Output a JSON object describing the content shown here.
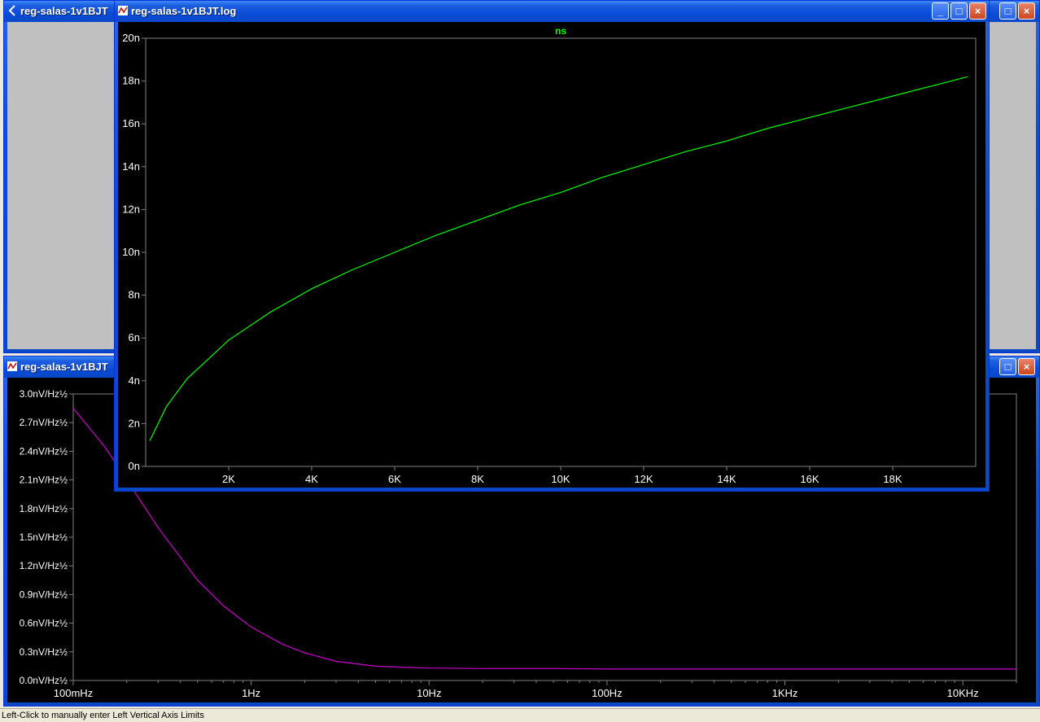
{
  "windows": {
    "schematic": {
      "title": "reg-salas-1v1BJT"
    },
    "noise_plot": {
      "title": "reg-salas-1v1BJT"
    },
    "log_plot": {
      "title": "reg-salas-1v1BJT.log"
    }
  },
  "status_text": "Left-Click to manually enter Left Vertical Axis Limits",
  "colors": {
    "trace_green": "#00ff00",
    "trace_magenta": "#cc00cc",
    "grid": "#808080",
    "axis_text": "#ffffff"
  },
  "chart_data": [
    {
      "type": "line",
      "legend_label": "ns",
      "x_ticks": [
        "2K",
        "4K",
        "6K",
        "8K",
        "10K",
        "12K",
        "14K",
        "16K",
        "18K"
      ],
      "y_ticks": [
        "0n",
        "2n",
        "4n",
        "6n",
        "8n",
        "10n",
        "12n",
        "14n",
        "16n",
        "18n",
        "20n"
      ],
      "xlim": [
        0,
        20000
      ],
      "ylim": [
        0,
        20
      ],
      "series": [
        {
          "x": [
            100,
            500,
            1000,
            2000,
            3000,
            4000,
            5000,
            6000,
            7000,
            8000,
            9000,
            10000,
            11000,
            12000,
            13000,
            14000,
            15000,
            16000,
            17000,
            18000,
            19000,
            19800
          ],
          "y": [
            1.2,
            2.8,
            4.1,
            5.9,
            7.2,
            8.3,
            9.2,
            10.0,
            10.8,
            11.5,
            12.2,
            12.8,
            13.5,
            14.1,
            14.7,
            15.2,
            15.8,
            16.3,
            16.8,
            17.3,
            17.8,
            18.2
          ]
        }
      ]
    },
    {
      "type": "line",
      "x_scale": "log",
      "x_ticks": [
        "100mHz",
        "1Hz",
        "10Hz",
        "100Hz",
        "1KHz",
        "10KHz"
      ],
      "y_ticks": [
        "0.0nV/Hz½",
        "0.3nV/Hz½",
        "0.6nV/Hz½",
        "0.9nV/Hz½",
        "1.2nV/Hz½",
        "1.5nV/Hz½",
        "1.8nV/Hz½",
        "2.1nV/Hz½",
        "2.4nV/Hz½",
        "2.7nV/Hz½",
        "3.0nV/Hz½"
      ],
      "xlim": [
        0.1,
        20000
      ],
      "ylim": [
        0,
        3.0
      ],
      "series": [
        {
          "x": [
            0.1,
            0.15,
            0.2,
            0.3,
            0.5,
            0.7,
            1,
            1.5,
            2,
            3,
            5,
            7,
            10,
            20,
            50,
            100,
            1000,
            10000,
            20000
          ],
          "y": [
            2.85,
            2.45,
            2.1,
            1.6,
            1.05,
            0.78,
            0.56,
            0.38,
            0.29,
            0.2,
            0.15,
            0.14,
            0.13,
            0.125,
            0.125,
            0.12,
            0.12,
            0.12,
            0.12
          ]
        }
      ]
    }
  ]
}
